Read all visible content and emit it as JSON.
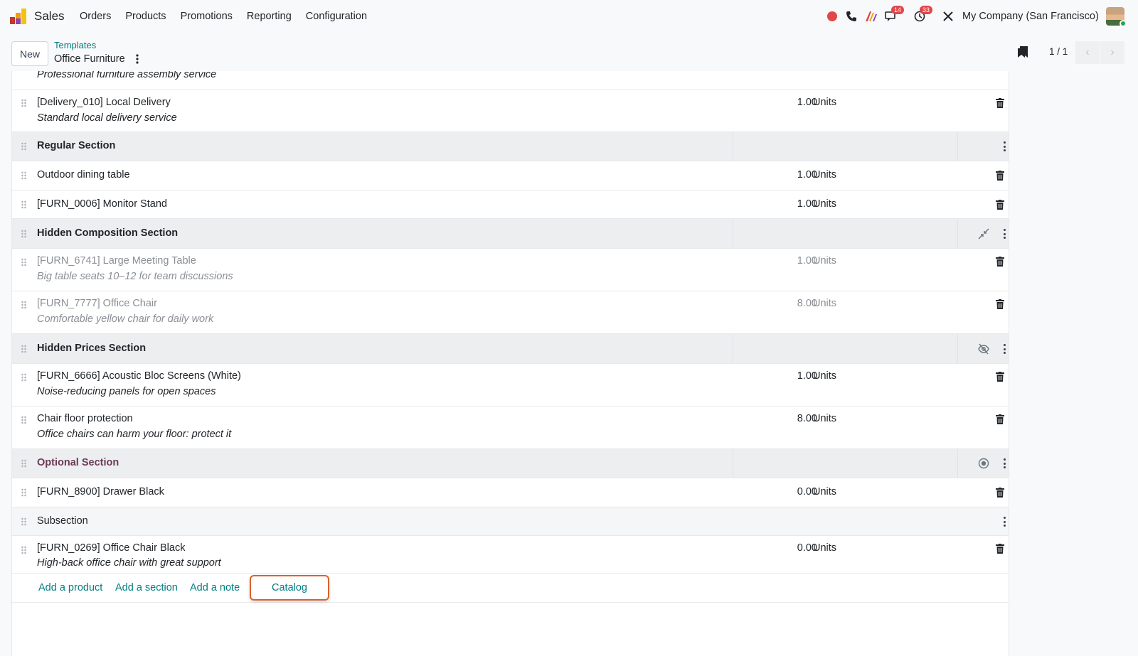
{
  "navbar": {
    "app_name": "Sales",
    "menu": [
      "Orders",
      "Products",
      "Promotions",
      "Reporting",
      "Configuration"
    ],
    "messages_badge": "14",
    "activities_badge": "33",
    "company": "My Company (San Francisco)"
  },
  "control_panel": {
    "new_label": "New",
    "breadcrumb_parent": "Templates",
    "breadcrumb_current": "Office Furniture",
    "pager": "1 / 1"
  },
  "lines": {
    "partial_top_desc": "Professional furniture assembly service",
    "delivery": {
      "name": "[Delivery_010] Local Delivery",
      "desc": "Standard local delivery service",
      "qty": "1.00",
      "uom": "Units"
    },
    "regular_section": "Regular Section",
    "outdoor": {
      "name": "Outdoor dining table",
      "qty": "1.00",
      "uom": "Units"
    },
    "monitor": {
      "name": "[FURN_0006] Monitor Stand",
      "qty": "1.00",
      "uom": "Units"
    },
    "hidden_comp_section": "Hidden Composition Section",
    "meeting": {
      "name": "[FURN_6741] Large Meeting Table",
      "desc": "Big table seats 10–12 for team discussions",
      "qty": "1.00",
      "uom": "Units"
    },
    "chair": {
      "name": "[FURN_7777] Office Chair",
      "desc": "Comfortable yellow chair for daily work",
      "qty": "8.00",
      "uom": "Units"
    },
    "hidden_prices_section": "Hidden Prices Section",
    "acoustic": {
      "name": "[FURN_6666] Acoustic Bloc Screens (White)",
      "desc": "Noise-reducing panels for open spaces",
      "qty": "1.00",
      "uom": "Units"
    },
    "floor": {
      "name": "Chair floor protection",
      "desc": "Office chairs can harm your floor: protect it",
      "qty": "8.00",
      "uom": "Units"
    },
    "optional_section": "Optional Section",
    "drawer": {
      "name": "[FURN_8900] Drawer Black",
      "qty": "0.00",
      "uom": "Units"
    },
    "subsection": "Subsection",
    "chair_black": {
      "name": "[FURN_0269] Office Chair Black",
      "desc": "High-back office chair with great support",
      "qty": "0.00",
      "uom": "Units"
    }
  },
  "actions": {
    "add_product": "Add a product",
    "add_section": "Add a section",
    "add_note": "Add a note",
    "catalog": "Catalog"
  },
  "colors": {
    "link": "#017e84",
    "highlight": "#d9622b",
    "optional": "#6b3a55",
    "badge": "#e0464a"
  }
}
